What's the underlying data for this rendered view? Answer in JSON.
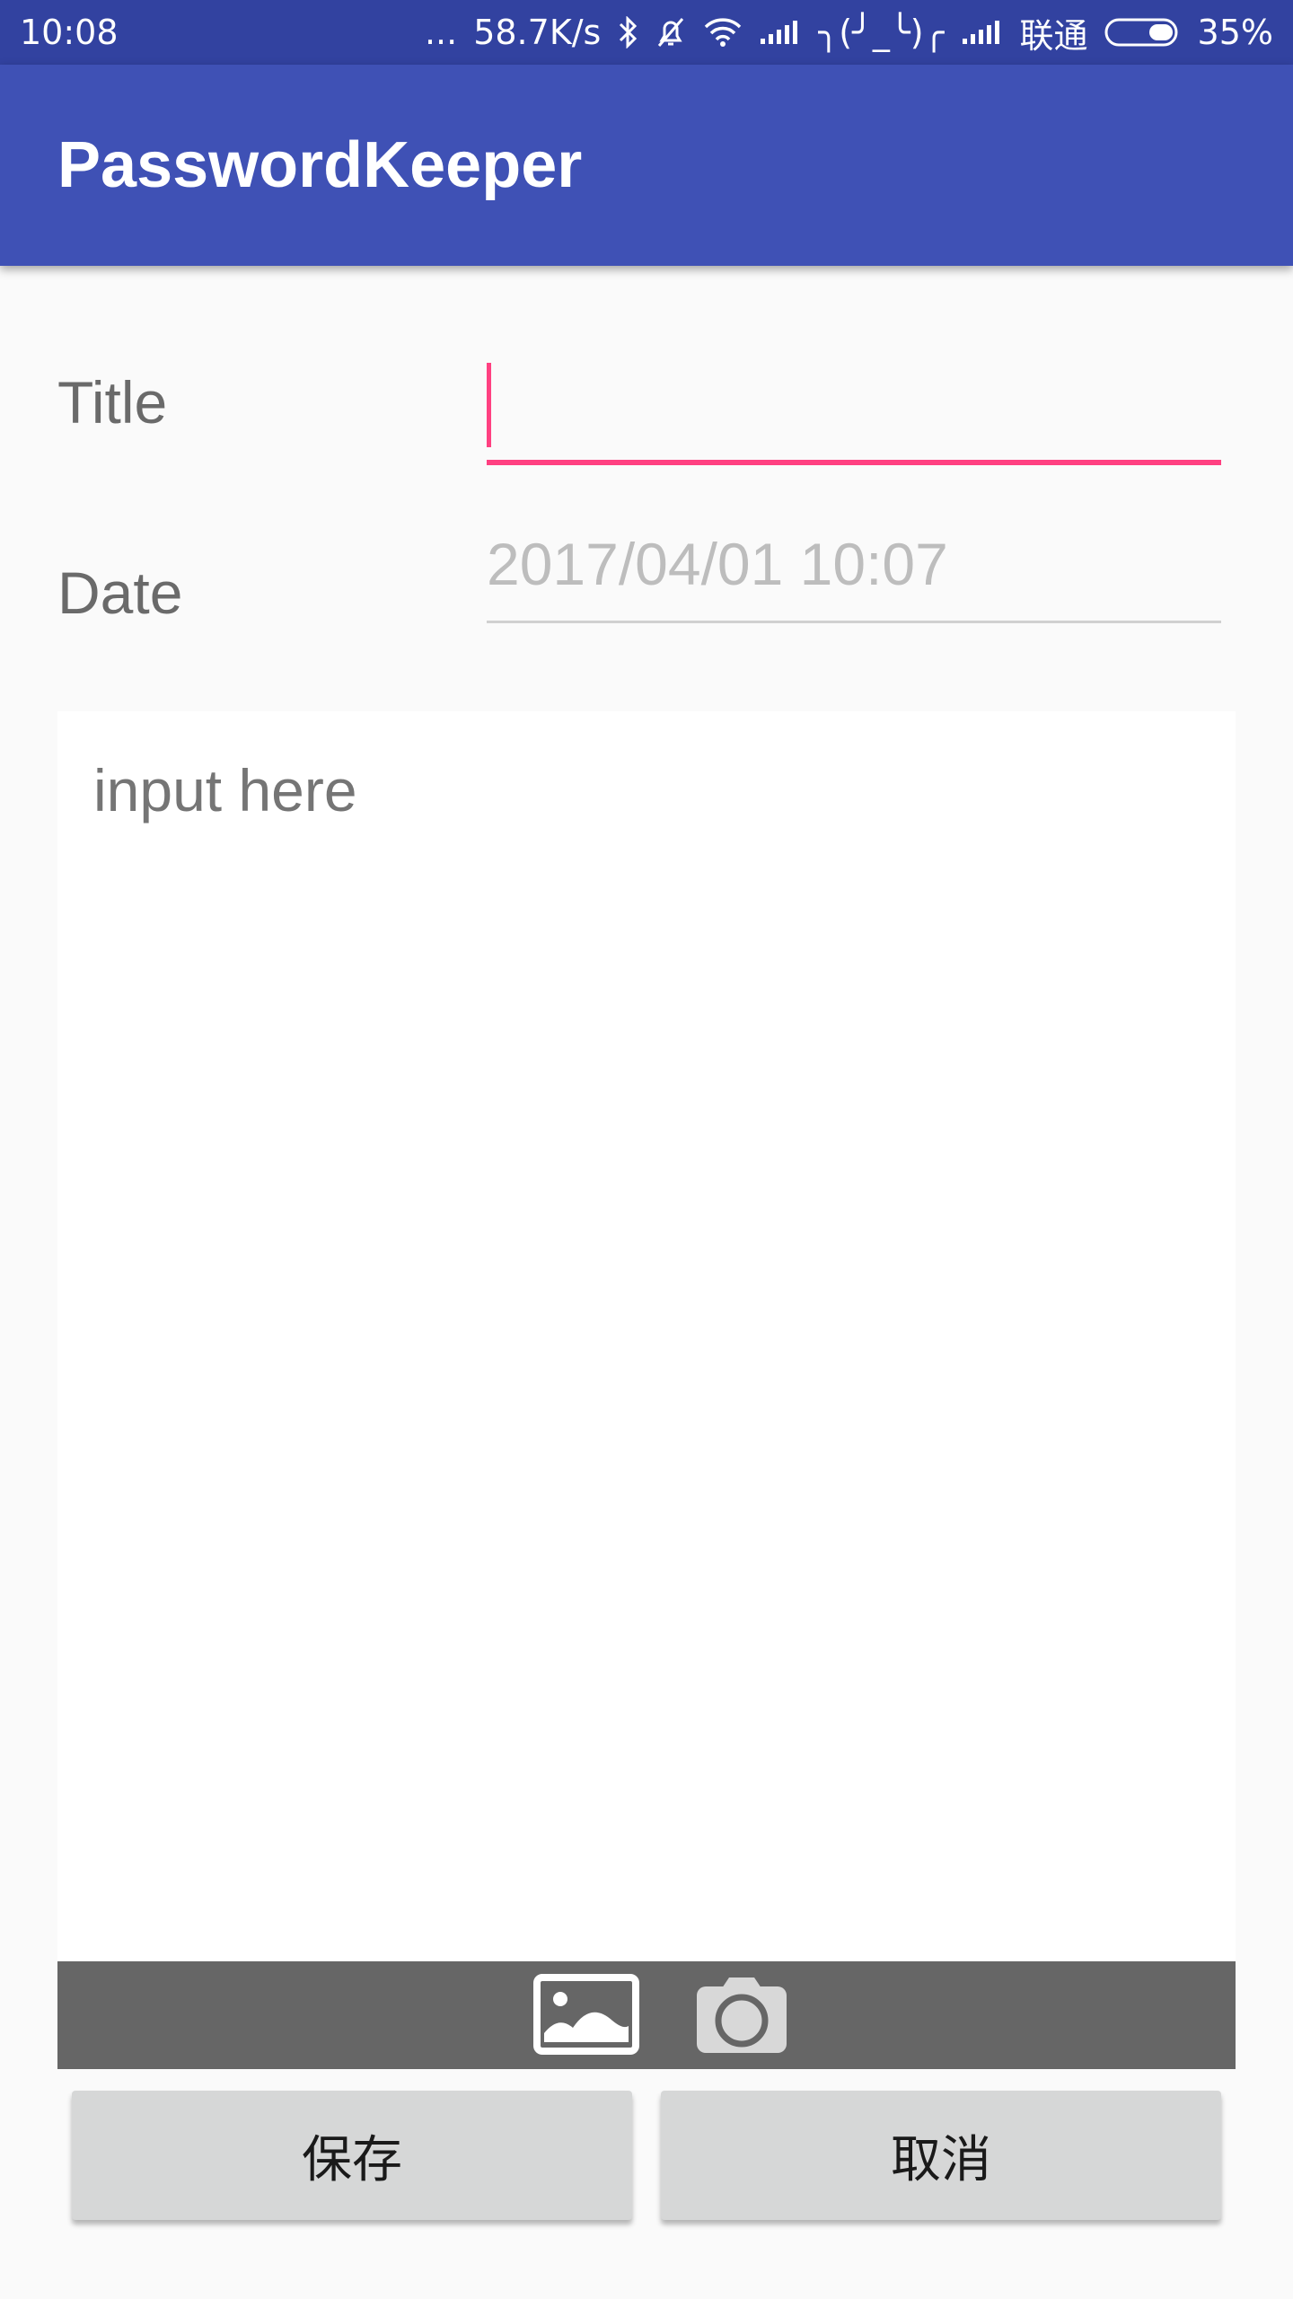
{
  "status_bar": {
    "time": "10:08",
    "dots": "...",
    "net_speed": "58.7K/s",
    "emoticon": "╮(╯_╰)╭",
    "carrier": "联通",
    "battery": "35%"
  },
  "app_bar": {
    "title": "PasswordKeeper"
  },
  "form": {
    "title_label": "Title",
    "title_value": "",
    "date_label": "Date",
    "date_value": "2017/04/01 10:07"
  },
  "content": {
    "placeholder": "input here"
  },
  "media_toolbar": {
    "gallery_icon": "image-icon",
    "camera_icon": "camera-icon"
  },
  "buttons": {
    "save_label": "保存",
    "cancel_label": "取消"
  },
  "colors": {
    "primary": "#3f51b5",
    "primary_dark": "#3242a0",
    "accent": "#ff4081",
    "toolbar_gray": "#666666",
    "button_gray": "#d6d7d7"
  }
}
